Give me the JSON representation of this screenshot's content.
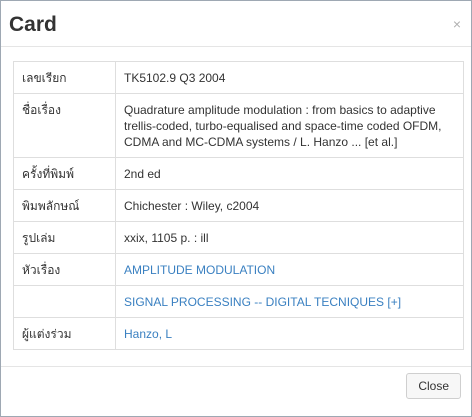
{
  "modal": {
    "title": "Card",
    "close_icon": "×",
    "close_button_label": "Close"
  },
  "record": {
    "call_number": {
      "label": "เลขเรียก",
      "value": "TK5102.9 Q3 2004"
    },
    "title": {
      "label": "ชื่อเรื่อง",
      "value": "Quadrature amplitude modulation : from basics to adaptive trellis-coded, turbo-equalised and space-time coded OFDM, CDMA and MC-CDMA systems / L. Hanzo ... [et al.]"
    },
    "edition": {
      "label": "ครั้งที่พิมพ์",
      "value": "2nd ed"
    },
    "publisher": {
      "label": "พิมพลักษณ์",
      "value": "Chichester : Wiley, c2004"
    },
    "physical": {
      "label": "รูปเล่ม",
      "value": "xxix, 1105 p. : ill"
    },
    "subjects": {
      "label": "หัวเรื่อง",
      "items": [
        "AMPLITUDE MODULATION",
        "SIGNAL PROCESSING -- DIGITAL TECNIQUES [+]"
      ]
    },
    "contributor": {
      "label": "ผู้แต่งร่วม",
      "value": "Hanzo, L"
    }
  },
  "colors": {
    "link": "#3a80c1",
    "border": "#dedede"
  }
}
